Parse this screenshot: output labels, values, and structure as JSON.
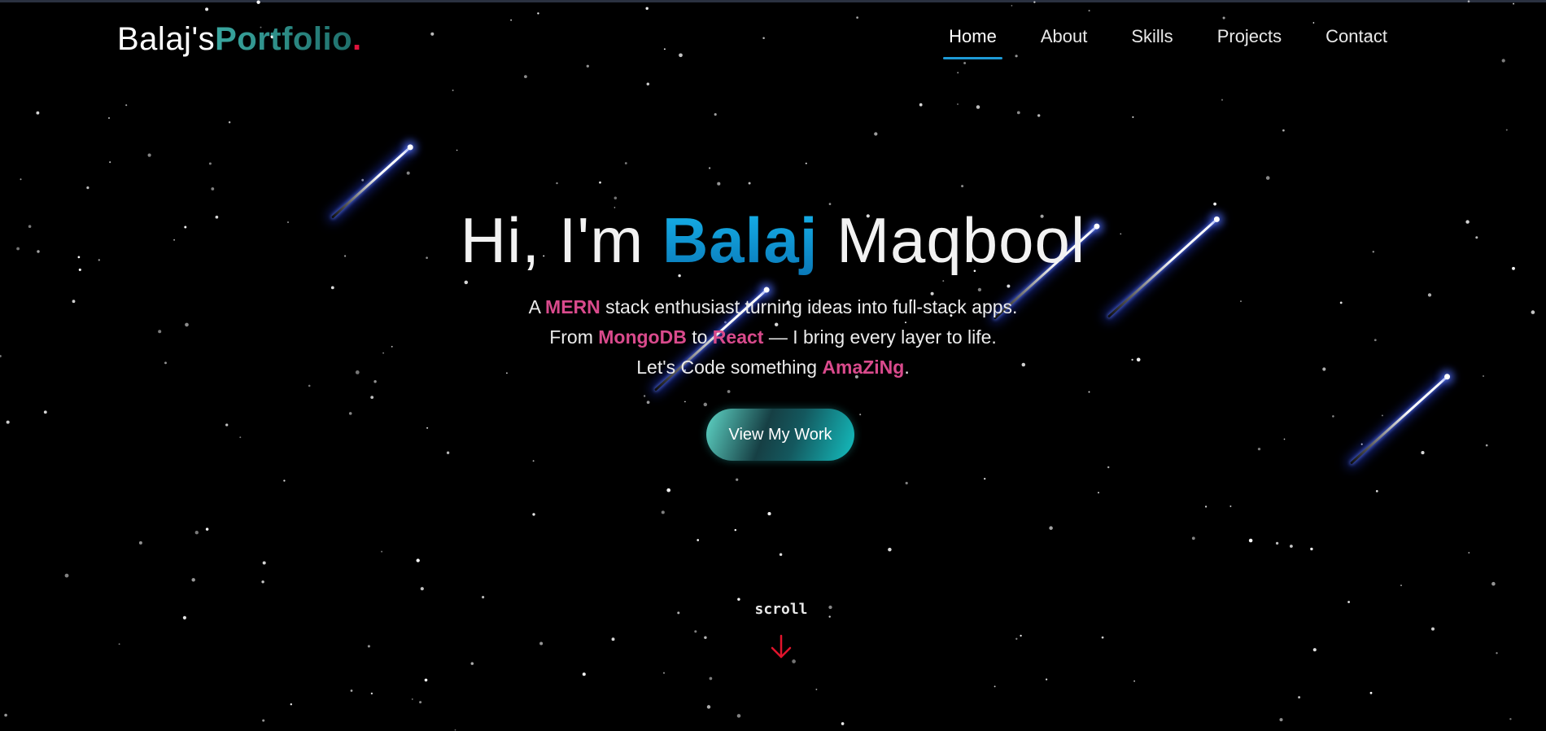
{
  "header": {
    "logo_prefix": "Balaj's",
    "logo_accent": "Portfolio",
    "logo_dot": "."
  },
  "nav": {
    "items": [
      "Home",
      "About",
      "Skills",
      "Projects",
      "Contact"
    ],
    "active": "Home"
  },
  "hero": {
    "greeting": "Hi, I'm",
    "first_name": "Balaj",
    "last_name": "Maqbool",
    "line1_a": "A",
    "line1_hl": "MERN",
    "line1_b": "stack enthusiast turning ideas into full-stack apps.",
    "line2_a": "From",
    "line2_hl1": "MongoDB",
    "line2_mid": "to",
    "line2_hl2": "React",
    "line2_b": "— I bring every layer to life.",
    "line3_a": "Let's Code something",
    "line3_hl": "AmaZiNg",
    "line3_b": ".",
    "cta_label": "View My Work"
  },
  "scroll_label": "scroll",
  "colors": {
    "background": "#000000",
    "accent_blue": "#1e9ad6",
    "highlight_pink": "#d94a8c",
    "teal": "#2f8f89",
    "dot_red": "#e0143c",
    "arrow_red": "#e0142c"
  },
  "icons": {
    "scroll_arrow": "arrow-down-icon"
  }
}
